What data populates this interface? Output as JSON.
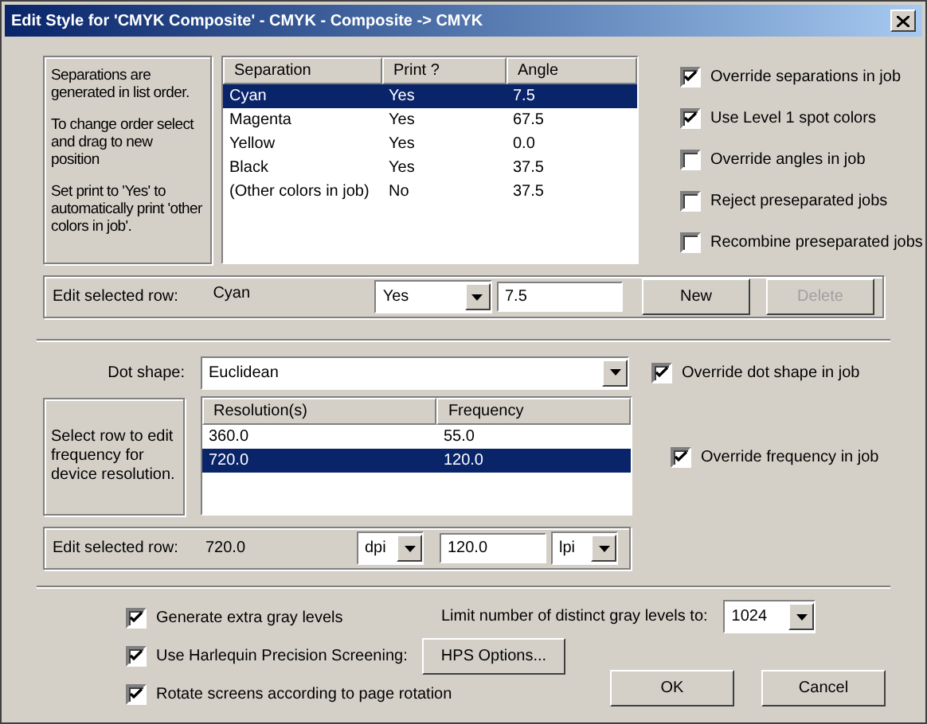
{
  "window": {
    "title": "Edit Style for 'CMYK Composite' - CMYK - Composite -> CMYK"
  },
  "separations": {
    "notes": [
      "Separations are generated in list order.",
      "To change order select and drag to new position",
      "Set print to 'Yes' to automatically print 'other colors in job'."
    ],
    "columns": [
      "Separation",
      "Print ?",
      "Angle"
    ],
    "rows": [
      {
        "cells": [
          "Cyan",
          "Yes",
          "7.5"
        ],
        "selected": true
      },
      {
        "cells": [
          "Magenta",
          "Yes",
          "67.5"
        ],
        "selected": false
      },
      {
        "cells": [
          "Yellow",
          "Yes",
          "0.0"
        ],
        "selected": false
      },
      {
        "cells": [
          "Black",
          "Yes",
          "37.5"
        ],
        "selected": false
      },
      {
        "cells": [
          "(Other colors in job)",
          "No",
          "37.5"
        ],
        "selected": false
      }
    ],
    "options": [
      {
        "label": "Override separations in job",
        "checked": true
      },
      {
        "label": "Use Level 1 spot colors",
        "checked": true
      },
      {
        "label": "Override angles in job",
        "checked": false
      },
      {
        "label": "Reject preseparated jobs",
        "checked": false
      },
      {
        "label": "Recombine preseparated jobs",
        "checked": false
      }
    ],
    "edit_row": {
      "label": "Edit selected row:",
      "name": "Cyan",
      "print": "Yes",
      "angle": "7.5",
      "buttons": [
        {
          "label": "New",
          "disabled": false
        },
        {
          "label": "Delete",
          "disabled": true
        }
      ]
    }
  },
  "screening": {
    "dot_shape_label": "Dot shape:",
    "dot_shape": "Euclidean",
    "override_dot_shape": {
      "label": "Override dot shape in job",
      "checked": true
    },
    "note": "Select row to edit frequency for device resolution.",
    "columns": [
      "Resolution(s)",
      "Frequency"
    ],
    "rows": [
      {
        "cells": [
          "360.0",
          "55.0"
        ],
        "selected": false
      },
      {
        "cells": [
          "720.0",
          "120.0"
        ],
        "selected": true
      }
    ],
    "override_frequency": {
      "label": "Override frequency in job",
      "checked": true
    },
    "edit_row": {
      "label": "Edit selected row:",
      "resolution": "720.0",
      "resolution_unit": "dpi",
      "frequency": "120.0",
      "frequency_unit": "lpi"
    }
  },
  "options": [
    {
      "label": "Generate extra gray levels",
      "checked": true
    },
    {
      "label": "Use Harlequin Precision Screening:",
      "checked": true
    },
    {
      "label": "Rotate screens according to page rotation",
      "checked": true
    }
  ],
  "gray_limit": {
    "label": "Limit number of distinct gray levels to:",
    "value": "1024"
  },
  "hps_button": "HPS Options...",
  "buttons": [
    "OK",
    "Cancel"
  ]
}
